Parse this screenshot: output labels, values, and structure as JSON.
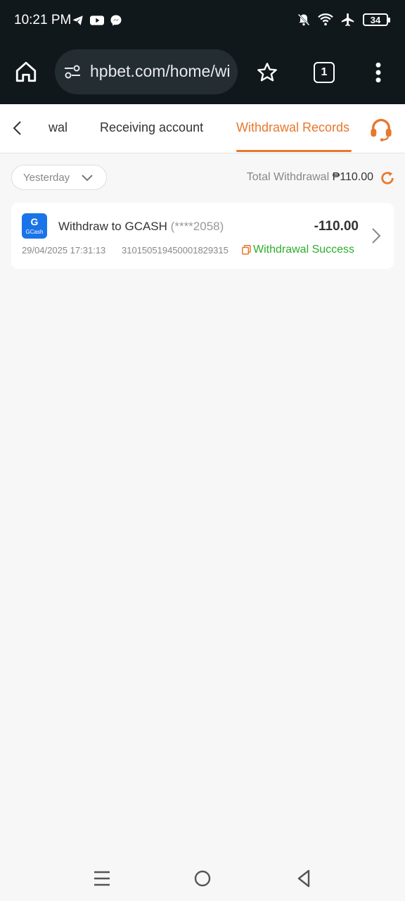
{
  "status_bar": {
    "time": "10:21 PM",
    "battery": "34",
    "app_icons": [
      "telegram-icon",
      "youtube-icon",
      "messenger-icon"
    ],
    "system_icons": [
      "mute-notifications-icon",
      "wifi-icon",
      "airplane-icon",
      "battery-icon"
    ]
  },
  "browser": {
    "url": "hpbet.com/home/wi",
    "tab_count": "1"
  },
  "header": {
    "tabs": [
      {
        "label": "wal"
      },
      {
        "label": "Receiving account"
      },
      {
        "label": "Withdrawal Records"
      }
    ],
    "active_tab": "Withdrawal Records",
    "accent_color": "#e8782c"
  },
  "filter": {
    "date_range": "Yesterday",
    "total_label": "Total Withdrawal",
    "total_amount": "₱110.00"
  },
  "records": [
    {
      "logo_text": "G",
      "logo_word": "GCash",
      "title": "Withdraw to GCASH",
      "account": "(****2058)",
      "amount": "-110.00",
      "datetime": "29/04/2025 17:31:13",
      "order_id": "3101505194500018293​15",
      "status": "Withdrawal Success",
      "status_color": "#2bae2b"
    }
  ]
}
